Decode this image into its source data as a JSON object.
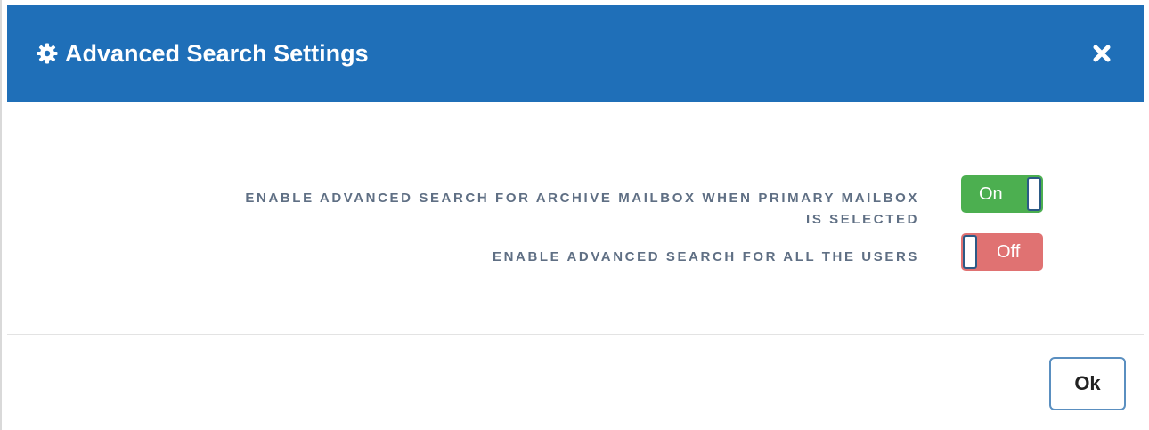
{
  "dialog": {
    "title": "Advanced Search Settings",
    "title_icon": "gear-icon",
    "close_icon": "close-icon"
  },
  "settings": [
    {
      "label": "ENABLE ADVANCED SEARCH FOR ARCHIVE MAILBOX WHEN PRIMARY MAILBOX IS SELECTED",
      "label_line1": "ENABLE ADVANCED SEARCH FOR ARCHIVE MAILBOX WHEN PRIMARY MAILBOX",
      "label_line2": "IS SELECTED",
      "state": "On",
      "enabled": true
    },
    {
      "label": "ENABLE ADVANCED SEARCH FOR ALL THE USERS",
      "state": "Off",
      "enabled": false
    }
  ],
  "footer": {
    "ok_label": "Ok"
  },
  "colors": {
    "header": "#1f6fb8",
    "toggle_on": "#4caf50",
    "toggle_off": "#e07272",
    "label_text": "#5f6f84"
  }
}
